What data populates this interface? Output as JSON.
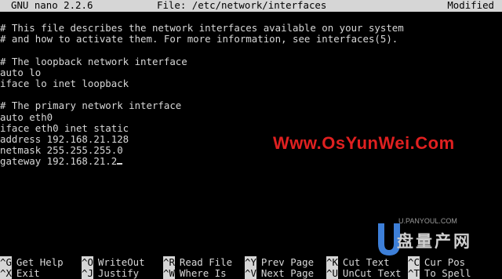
{
  "titlebar": {
    "app": "GNU nano 2.2.6",
    "file": "File: /etc/network/interfaces",
    "status": "Modified"
  },
  "editor": {
    "lines": [
      "# This file describes the network interfaces available on your system",
      "# and how to activate them. For more information, see interfaces(5).",
      "",
      "# The loopback network interface",
      "auto lo",
      "iface lo inet loopback",
      "",
      "# The primary network interface",
      "auto eth0",
      "iface eth0 inet static",
      "address 192.168.21.128",
      "netmask 255.255.255.0",
      "gateway 192.168.21.2"
    ]
  },
  "watermark": "Www.OsYunWei.Com",
  "logo": {
    "url": "U.PANYOUL.COM",
    "text": "盘量产网"
  },
  "shortcuts": {
    "row1": [
      {
        "key": "^G",
        "label": "Get Help"
      },
      {
        "key": "^O",
        "label": "WriteOut"
      },
      {
        "key": "^R",
        "label": "Read File"
      },
      {
        "key": "^Y",
        "label": "Prev Page"
      },
      {
        "key": "^K",
        "label": "Cut Text"
      },
      {
        "key": "^C",
        "label": "Cur Pos"
      }
    ],
    "row2": [
      {
        "key": "^X",
        "label": "Exit"
      },
      {
        "key": "^J",
        "label": "Justify"
      },
      {
        "key": "^W",
        "label": "Where Is"
      },
      {
        "key": "^V",
        "label": "Next Page"
      },
      {
        "key": "^U",
        "label": "UnCut Text"
      },
      {
        "key": "^T",
        "label": "To Spell"
      }
    ]
  },
  "colors": {
    "background": "#000000",
    "text": "#d8d8d8",
    "highlight": "#d6d6d6",
    "watermark": "#e02020"
  }
}
